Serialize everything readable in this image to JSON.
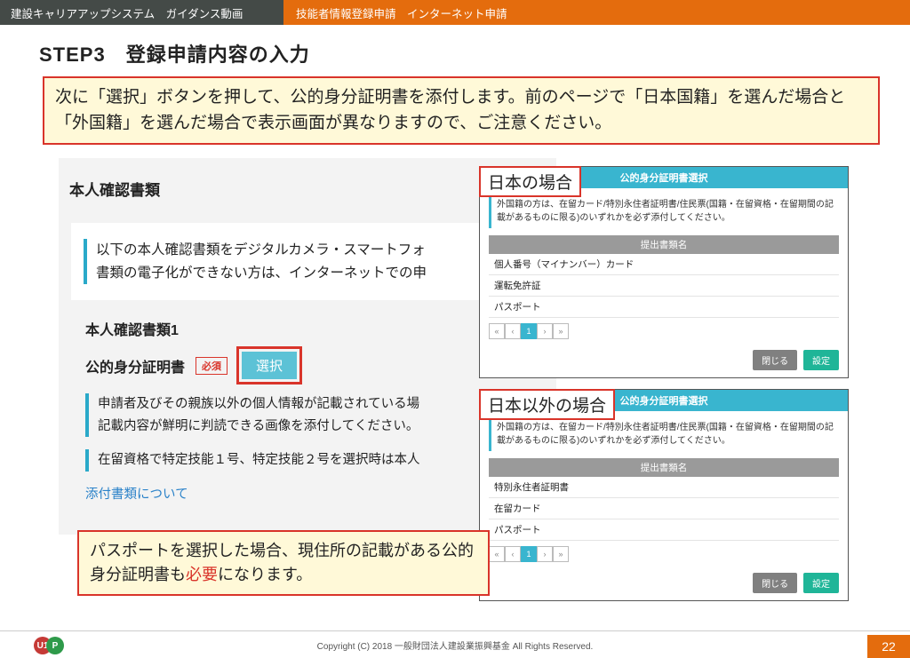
{
  "topbar": {
    "left": "建設キャリアアップシステム　ガイダンス動画",
    "right": "技能者情報登録申請　インターネット申請"
  },
  "step_title": "STEP3　登録申請内容の入力",
  "callout_top": "次に「選択」ボタンを押して、公的身分証明書を添付します。前のページで「日本国籍」を選んだ場合と「外国籍」を選んだ場合で表示画面が異なりますので、ご注意ください。",
  "panel": {
    "title": "本人確認書類",
    "intro1": "以下の本人確認書類をデジタルカメラ・スマートフォ",
    "intro2": "書類の電子化ができない方は、インターネットでの申",
    "sub_heading": "本人確認書類1",
    "field_label": "公的身分証明書",
    "required_badge": "必須",
    "select_button": "選択",
    "note1": "申請者及びその親族以外の個人情報が記載されている場",
    "note2": "記載内容が鮮明に判読できる画像を添付してください。",
    "note3": "在留資格で特定技能１号、特定技能２号を選択時は本人",
    "link": "添付書類について"
  },
  "callout_bottom_pre": "パスポートを選択した場合、現住所の記載がある公的身分証明書も",
  "callout_bottom_red": "必要",
  "callout_bottom_post": "になります。",
  "popup_jp": {
    "label": "日本の場合",
    "header": "公的身分証明書選択",
    "note": "外国籍の方は、在留カード/特別永住者証明書/住民票(国籍・在留資格・在留期間の記載があるものに限る)のいずれかを必ず添付してください。",
    "col_header": "提出書類名",
    "rows": [
      "個人番号（マイナンバー）カード",
      "運転免許証",
      "パスポート"
    ],
    "close": "閉じる",
    "set": "設定"
  },
  "popup_frn": {
    "label": "日本以外の場合",
    "header": "公的身分証明書選択",
    "note": "外国籍の方は、在留カード/特別永住者証明書/住民票(国籍・在留資格・在留期間の記載があるものに限る)のいずれかを必ず添付してください。",
    "col_header": "提出書類名",
    "rows": [
      "特別永住者証明書",
      "在留カード",
      "パスポート"
    ],
    "close": "閉じる",
    "set": "設定"
  },
  "footer": {
    "copyright": "Copyright (C) 2018 一般財団法人建設業振興基金 All Rights Reserved.",
    "page": "22"
  }
}
